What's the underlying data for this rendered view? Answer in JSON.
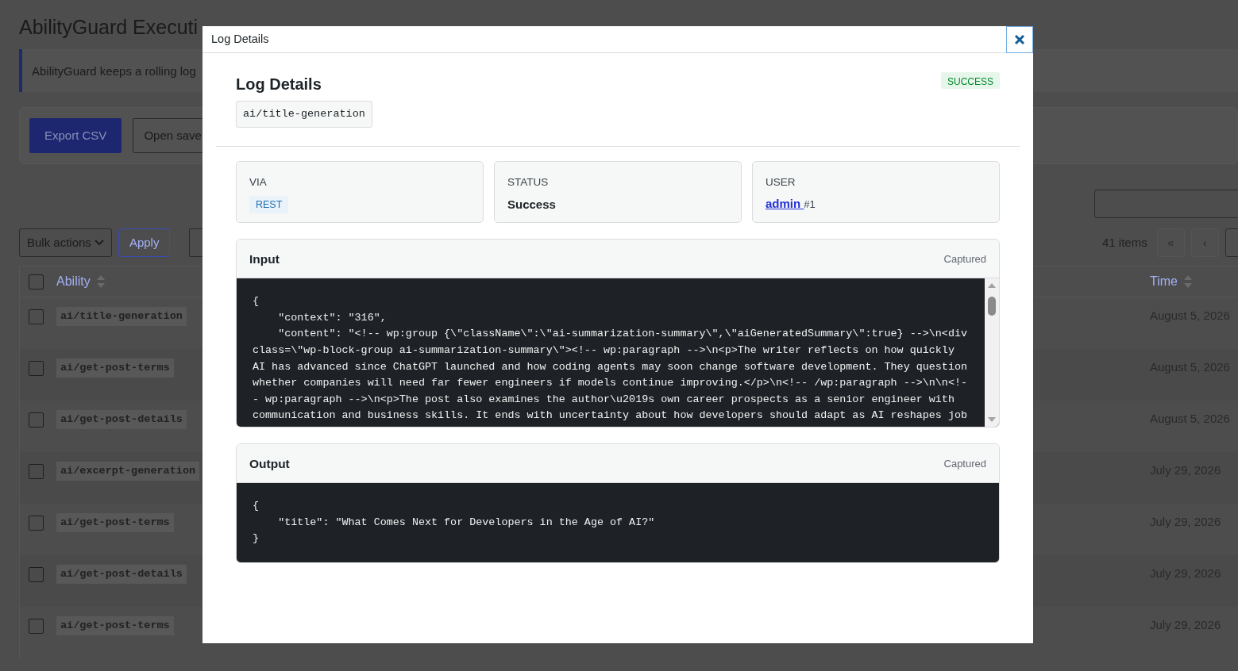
{
  "page": {
    "title": "AbilityGuard Executi",
    "notice": "AbilityGuard keeps a rolling log",
    "toolbar": [
      "Export CSV",
      "Open save"
    ],
    "bulk_select": "Bulk actions",
    "apply": "Apply",
    "items_count": "41 items",
    "pagination": [
      "«",
      "‹"
    ]
  },
  "table": {
    "select_all_checked": false,
    "columns": [
      {
        "label": "Ability"
      },
      {
        "label": "Time"
      }
    ],
    "rows": [
      {
        "checked": false,
        "ability": "ai/title-generation",
        "time": "August 5, 2026"
      },
      {
        "checked": false,
        "ability": "ai/get-post-terms",
        "time": "August 5, 2026"
      },
      {
        "checked": false,
        "ability": "ai/get-post-details",
        "time": "August 5, 2026"
      },
      {
        "checked": false,
        "ability": "ai/excerpt-generation",
        "time": "July 29, 2026"
      },
      {
        "checked": false,
        "ability": "ai/get-post-terms",
        "time": "July 29, 2026"
      },
      {
        "checked": false,
        "ability": "ai/get-post-details",
        "time": "July 29, 2026"
      },
      {
        "checked": false,
        "ability": "ai/get-post-terms",
        "time": "July 29, 2026"
      }
    ]
  },
  "modal": {
    "title": "Log Details",
    "heading": "Log Details",
    "ability": "ai/title-generation",
    "status_badge": "SUCCESS",
    "fields": [
      {
        "kind": "badge",
        "label": "VIA",
        "value": "REST"
      },
      {
        "kind": "text",
        "label": "STATUS",
        "value": "Success"
      },
      {
        "kind": "link",
        "label": "USER",
        "value": "admin ",
        "suffix": "#1"
      }
    ],
    "panels": [
      {
        "title": "Input",
        "note": "Captured",
        "scrollable": true,
        "lines": [
          "{",
          "    \"context\": \"316\",",
          "    \"content\": \"<!-- wp:group {\\\"className\\\":\\\"ai-summarization-summary\\\",\\\"aiGeneratedSummary\\\":true} -->\\n<div",
          "class=\\\"wp-block-group ai-summarization-summary\\\"><!-- wp:paragraph -->\\n<p>The writer reflects on how quickly",
          "AI has advanced since ChatGPT launched and how coding agents may soon change software development. They question",
          "whether companies will need far fewer engineers if models continue improving.</p>\\n<!-- /wp:paragraph -->\\n\\n<!-",
          "- wp:paragraph -->\\n<p>The post also examines the author\\u2019s own career prospects as a senior engineer with",
          "communication and business skills. It ends with uncertainty about how developers should adapt as AI reshapes job"
        ]
      },
      {
        "title": "Output",
        "note": "Captured",
        "scrollable": false,
        "lines": [
          "{",
          "    \"title\": \"What Comes Next for Developers in the Age of AI?\"",
          "}"
        ]
      }
    ]
  }
}
